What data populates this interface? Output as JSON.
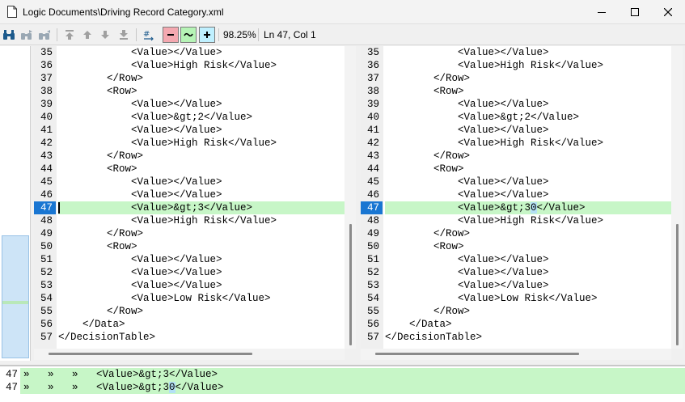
{
  "window": {
    "title": "Logic Documents\\Driving Record Category.xml",
    "icons": [
      "document-icon",
      "minimize-icon",
      "maximize-icon",
      "close-icon"
    ]
  },
  "toolbar": {
    "zoom": "98.25%",
    "position": "Ln 47, Col 1"
  },
  "left_pane": {
    "lines": [
      {
        "n": "35",
        "text": "            <Value></Value>"
      },
      {
        "n": "36",
        "text": "            <Value>High Risk</Value>"
      },
      {
        "n": "37",
        "text": "        </Row>"
      },
      {
        "n": "38",
        "text": "        <Row>"
      },
      {
        "n": "39",
        "text": "            <Value></Value>"
      },
      {
        "n": "40",
        "text": "            <Value>&gt;2</Value>"
      },
      {
        "n": "41",
        "text": "            <Value></Value>"
      },
      {
        "n": "42",
        "text": "            <Value>High Risk</Value>"
      },
      {
        "n": "43",
        "text": "        </Row>"
      },
      {
        "n": "44",
        "text": "        <Row>"
      },
      {
        "n": "45",
        "text": "            <Value></Value>"
      },
      {
        "n": "46",
        "text": "            <Value></Value>"
      },
      {
        "n": "47",
        "text": "            <Value>&gt;3</Value>"
      },
      {
        "n": "48",
        "text": "            <Value>High Risk</Value>"
      },
      {
        "n": "49",
        "text": "        </Row>"
      },
      {
        "n": "50",
        "text": "        <Row>"
      },
      {
        "n": "51",
        "text": "            <Value></Value>"
      },
      {
        "n": "52",
        "text": "            <Value></Value>"
      },
      {
        "n": "53",
        "text": "            <Value></Value>"
      },
      {
        "n": "54",
        "text": "            <Value>Low Risk</Value>"
      },
      {
        "n": "55",
        "text": "        </Row>"
      },
      {
        "n": "56",
        "text": "    </Data>"
      },
      {
        "n": "57",
        "text": "</DecisionTable>"
      }
    ]
  },
  "right_pane": {
    "lines": [
      {
        "n": "35",
        "text": "            <Value></Value>"
      },
      {
        "n": "36",
        "text": "            <Value>High Risk</Value>"
      },
      {
        "n": "37",
        "text": "        </Row>"
      },
      {
        "n": "38",
        "text": "        <Row>"
      },
      {
        "n": "39",
        "text": "            <Value></Value>"
      },
      {
        "n": "40",
        "text": "            <Value>&gt;2</Value>"
      },
      {
        "n": "41",
        "text": "            <Value></Value>"
      },
      {
        "n": "42",
        "text": "            <Value>High Risk</Value>"
      },
      {
        "n": "43",
        "text": "        </Row>"
      },
      {
        "n": "44",
        "text": "        <Row>"
      },
      {
        "n": "45",
        "text": "            <Value></Value>"
      },
      {
        "n": "46",
        "text": "            <Value></Value>"
      },
      {
        "n": "47",
        "pre": "            <Value>&gt;3",
        "diff": "0",
        "post": "</Value>"
      },
      {
        "n": "48",
        "text": "            <Value>High Risk</Value>"
      },
      {
        "n": "49",
        "text": "        </Row>"
      },
      {
        "n": "50",
        "text": "        <Row>"
      },
      {
        "n": "51",
        "text": "            <Value></Value>"
      },
      {
        "n": "52",
        "text": "            <Value></Value>"
      },
      {
        "n": "53",
        "text": "            <Value></Value>"
      },
      {
        "n": "54",
        "text": "            <Value>Low Risk</Value>"
      },
      {
        "n": "55",
        "text": "        </Row>"
      },
      {
        "n": "56",
        "text": "    </Data>"
      },
      {
        "n": "57",
        "text": "</DecisionTable>"
      }
    ]
  },
  "highlight_line": "47",
  "bottom_compare": {
    "left": {
      "n": "47",
      "tabs": "»   »   »   ",
      "text": "<Value>&gt;3</Value>"
    },
    "right": {
      "n": "47",
      "tabs": "»   »   »   ",
      "pre": "<Value>&gt;3",
      "diff": "0",
      "post": "</Value>"
    }
  }
}
